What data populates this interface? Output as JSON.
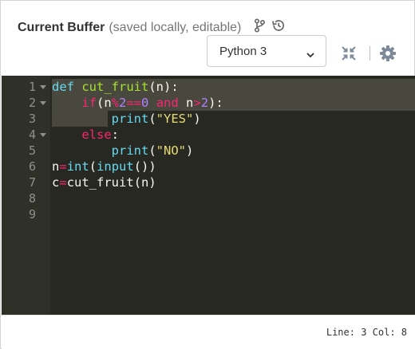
{
  "header": {
    "title": "Current Buffer",
    "subtitle": "(saved locally, editable)",
    "icons": [
      "branch-icon",
      "history-icon",
      "collapse-icon",
      "gear-icon"
    ]
  },
  "language_select": {
    "value": "Python 3"
  },
  "editor": {
    "line_numbers": [
      "1",
      "2",
      "3",
      "4",
      "5",
      "6",
      "7",
      "8",
      "9"
    ],
    "fold_lines": [
      1,
      2,
      4
    ],
    "lines": [
      [
        {
          "t": "def",
          "c": "kwd"
        },
        {
          "t": " ",
          "c": "txt"
        },
        {
          "t": "cut_fruit",
          "c": "fn"
        },
        {
          "t": "(n):",
          "c": "txt"
        }
      ],
      [
        {
          "t": "    ",
          "c": "txt"
        },
        {
          "t": "if",
          "c": "kw"
        },
        {
          "t": "(n",
          "c": "txt"
        },
        {
          "t": "%",
          "c": "kw"
        },
        {
          "t": "2",
          "c": "num-t"
        },
        {
          "t": "==",
          "c": "kw"
        },
        {
          "t": "0",
          "c": "num-t"
        },
        {
          "t": " ",
          "c": "txt"
        },
        {
          "t": "and",
          "c": "kw"
        },
        {
          "t": " n",
          "c": "txt"
        },
        {
          "t": ">",
          "c": "kw"
        },
        {
          "t": "2",
          "c": "num-t"
        },
        {
          "t": "):",
          "c": "txt"
        }
      ],
      [
        {
          "t": "        ",
          "c": "txt"
        },
        {
          "t": "print",
          "c": "bi"
        },
        {
          "t": "(",
          "c": "txt"
        },
        {
          "t": "\"YES\"",
          "c": "str"
        },
        {
          "t": ")",
          "c": "txt"
        }
      ],
      [
        {
          "t": "    ",
          "c": "txt"
        },
        {
          "t": "else",
          "c": "kw"
        },
        {
          "t": ":",
          "c": "txt"
        }
      ],
      [
        {
          "t": "        ",
          "c": "txt"
        },
        {
          "t": "print",
          "c": "bi"
        },
        {
          "t": "(",
          "c": "txt"
        },
        {
          "t": "\"NO\"",
          "c": "str"
        },
        {
          "t": ")",
          "c": "txt"
        }
      ],
      [
        {
          "t": "n",
          "c": "txt"
        },
        {
          "t": "=",
          "c": "kw"
        },
        {
          "t": "int",
          "c": "bi"
        },
        {
          "t": "(",
          "c": "txt"
        },
        {
          "t": "input",
          "c": "bi"
        },
        {
          "t": "())",
          "c": "txt"
        }
      ],
      [
        {
          "t": "c",
          "c": "txt"
        },
        {
          "t": "=",
          "c": "kw"
        },
        {
          "t": "cut_fruit",
          "c": "txt"
        },
        {
          "t": "(n)",
          "c": "txt"
        }
      ],
      [],
      []
    ]
  },
  "status": {
    "text": "Line: 3 Col: 8"
  },
  "colors": {
    "editor_bg": "#272822",
    "gutter_bg": "#2f3129",
    "selection": "#49483e",
    "keyword": "#f92672",
    "def_keyword": "#66d9ef",
    "function_name": "#a6e22e",
    "number": "#ae81ff",
    "string": "#e6db74"
  }
}
